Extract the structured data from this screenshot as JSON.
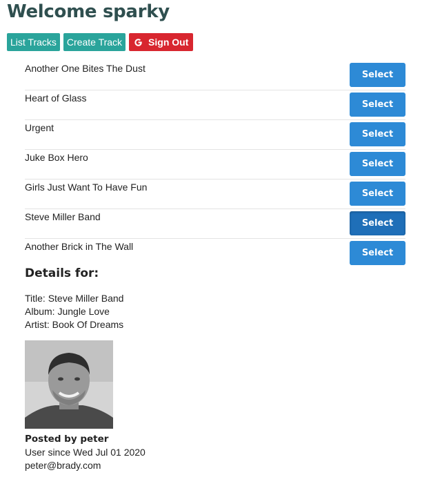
{
  "header": {
    "title": "Welcome sparky"
  },
  "nav": {
    "list_tracks": "List Tracks",
    "create_track": "Create Track",
    "sign_out": "Sign Out",
    "sign_out_icon": "google-icon"
  },
  "tracks": [
    {
      "name": "Another One Bites The Dust",
      "button": "Select"
    },
    {
      "name": "Heart of Glass",
      "button": "Select"
    },
    {
      "name": "Urgent",
      "button": "Select"
    },
    {
      "name": "Juke Box Hero",
      "button": "Select"
    },
    {
      "name": "Girls Just Want To Have Fun",
      "button": "Select"
    },
    {
      "name": "Steve Miller Band",
      "button": "Select"
    },
    {
      "name": "Another Brick in The Wall",
      "button": "Select"
    }
  ],
  "details": {
    "heading": "Details for:",
    "title": "Title: Steve Miller Band",
    "album": "Album: Jungle Love",
    "artist": "Artist: Book Of Dreams"
  },
  "poster": {
    "posted_by": "Posted by peter",
    "user_since": "User since Wed Jul 01 2020",
    "email": "peter@brady.com"
  },
  "colors": {
    "teal": "#2aa49b",
    "red": "#d8262f",
    "blue": "#2d8ad6",
    "title": "#2f4f4f"
  }
}
